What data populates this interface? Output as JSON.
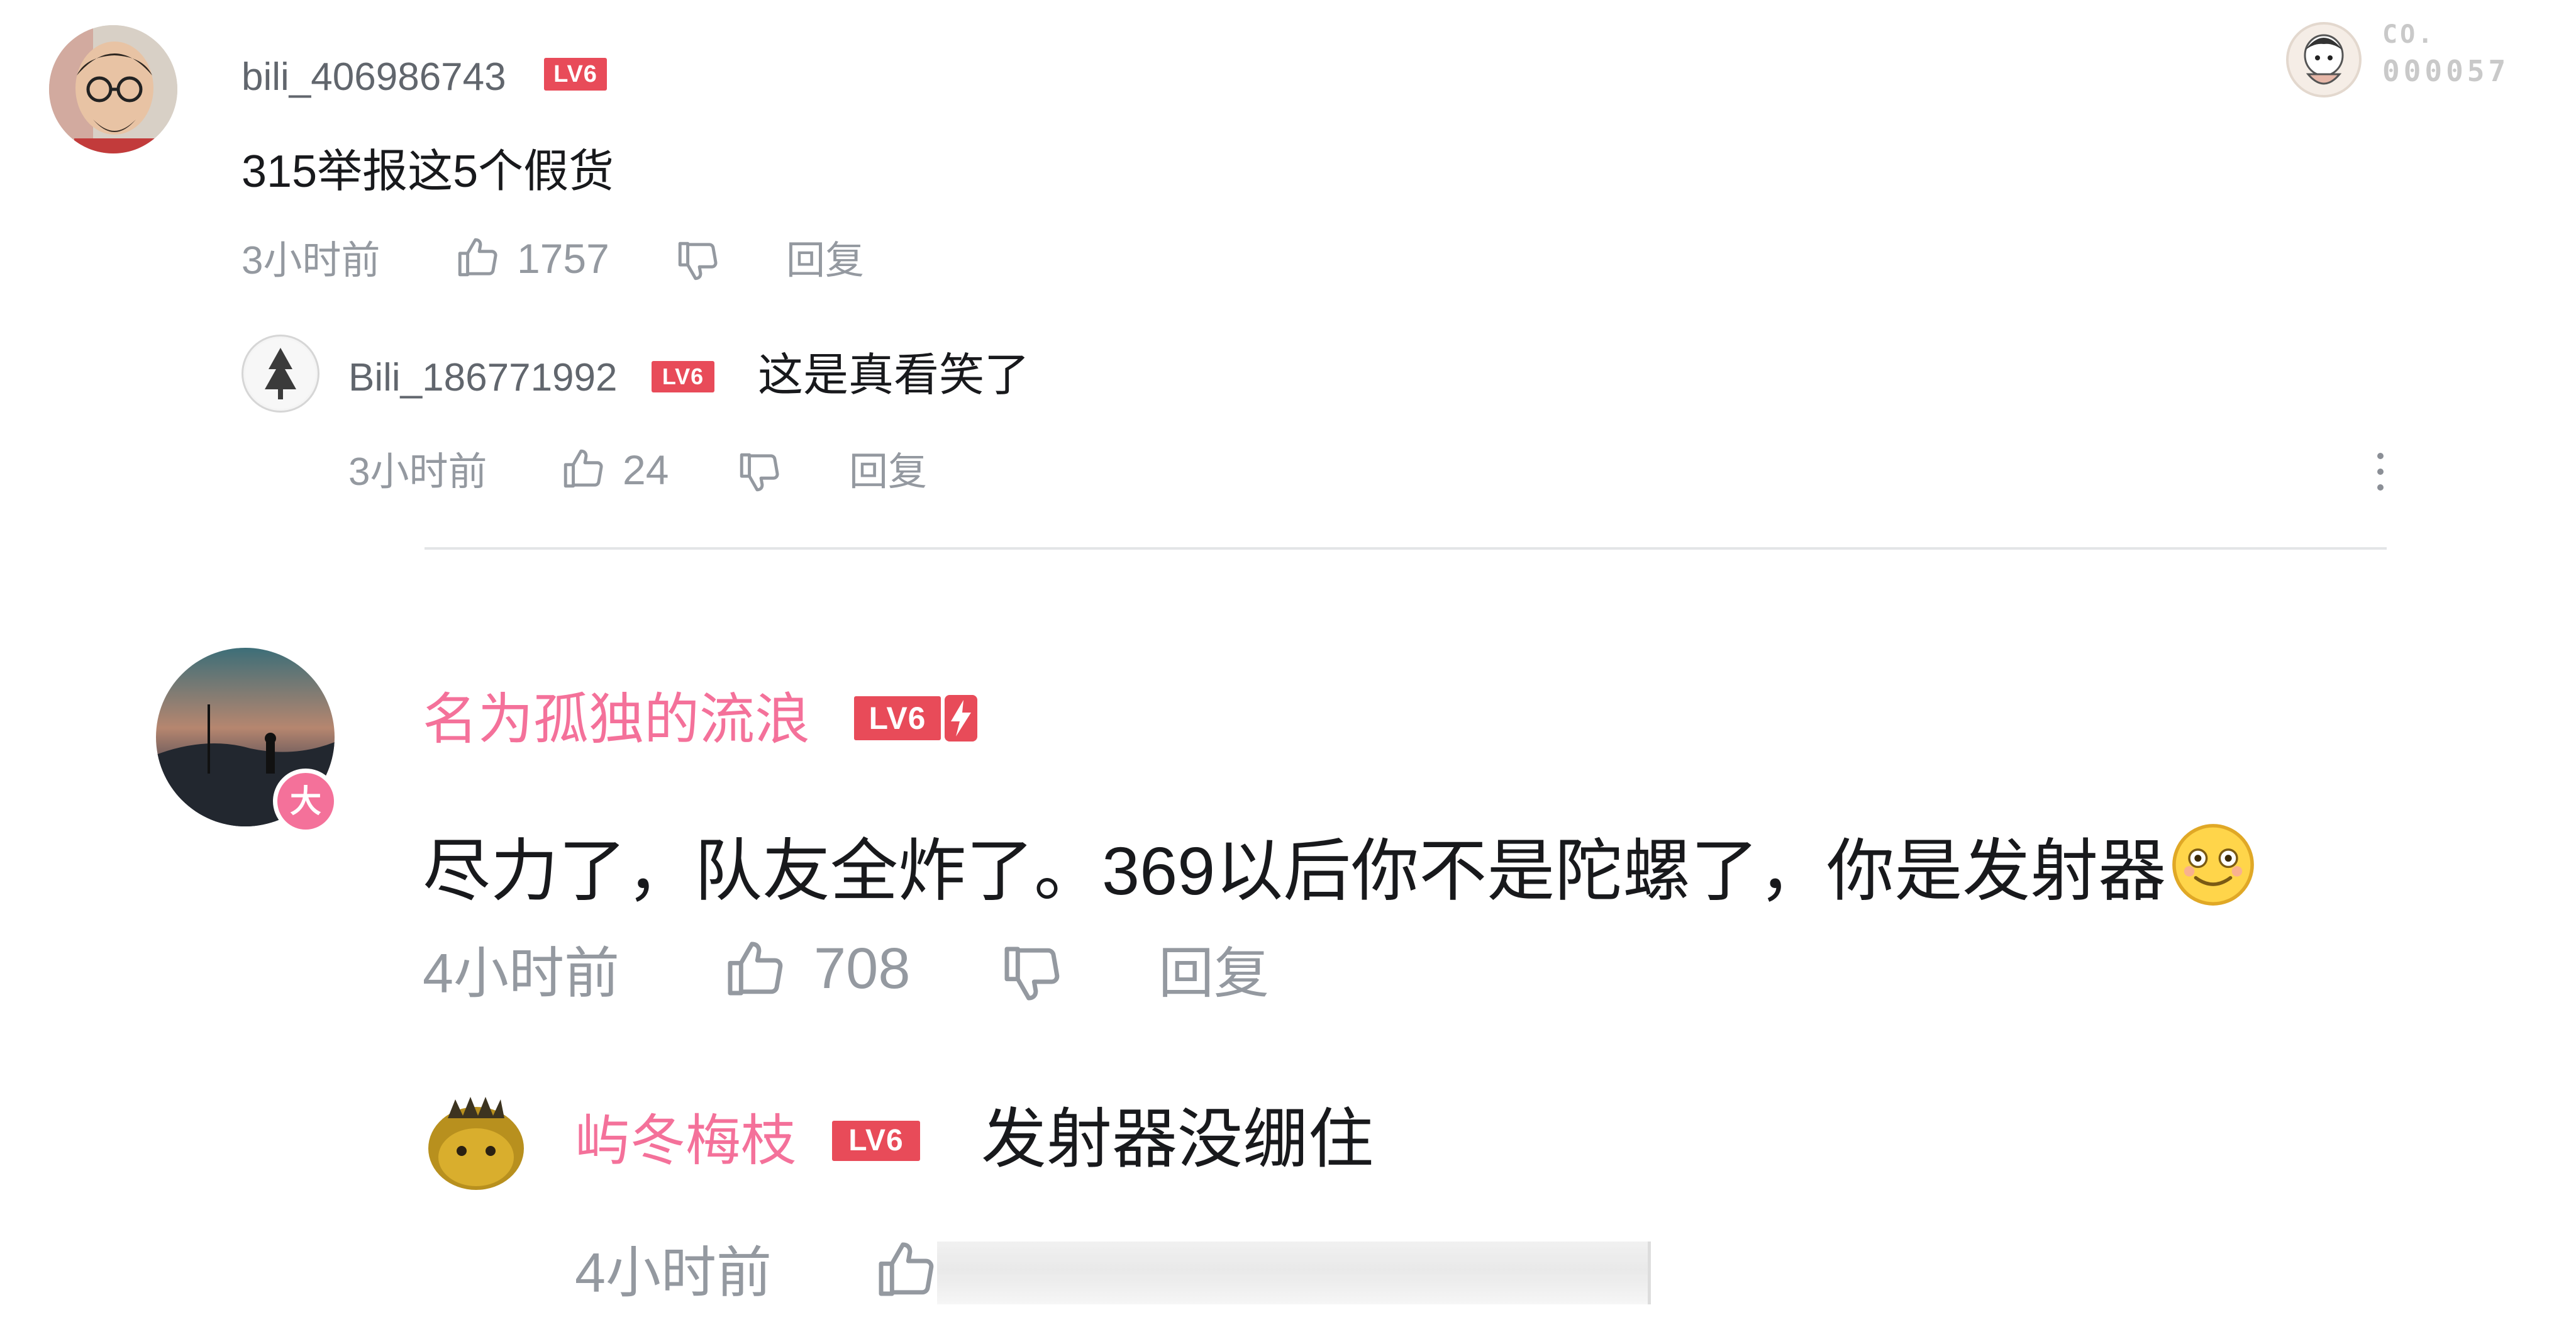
{
  "badge": {
    "line1": "CO.",
    "line2": "000057"
  },
  "colors": {
    "vip_name": "#f4719a",
    "level_badge": "#e84b59",
    "meta": "#9499a0",
    "text": "#18191c"
  },
  "comments": [
    {
      "username": "bili_406986743",
      "level": "LV6",
      "content": "315举报这5个假货",
      "time": "3小时前",
      "likes": "1757",
      "reply_label": "回复",
      "replies": [
        {
          "username": "Bili_186771992",
          "level": "LV6",
          "content": "这是真看笑了",
          "time": "3小时前",
          "likes": "24",
          "reply_label": "回复"
        }
      ]
    },
    {
      "username": "名为孤独的流浪",
      "level": "LV6",
      "avatar_badge": "大",
      "content": "尽力了，队友全炸了。369以后你不是陀螺了，你是发射器",
      "time": "4小时前",
      "likes": "708",
      "reply_label": "回复",
      "replies": [
        {
          "username": "屿冬梅枝",
          "level": "LV6",
          "content": "发射器没绷住",
          "time": "4小时前"
        }
      ]
    }
  ]
}
